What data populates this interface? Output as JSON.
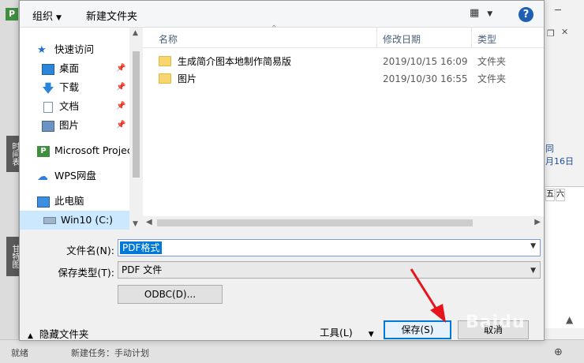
{
  "toolbar": {
    "organize": "组织",
    "new_folder": "新建文件夹",
    "help": "?"
  },
  "nav": {
    "items": [
      {
        "label": "快速访问",
        "icon": "star-icon"
      },
      {
        "label": "桌面",
        "icon": "desktop-icon",
        "pinned": true
      },
      {
        "label": "下载",
        "icon": "download-icon",
        "pinned": true
      },
      {
        "label": "文档",
        "icon": "document-icon",
        "pinned": true
      },
      {
        "label": "图片",
        "icon": "picture-icon",
        "pinned": true
      },
      {
        "label": "Microsoft Project",
        "icon": "project-icon"
      },
      {
        "label": "WPS网盘",
        "icon": "cloud-icon"
      },
      {
        "label": "此电脑",
        "icon": "computer-icon"
      },
      {
        "label": "Win10 (C:)",
        "icon": "drive-icon",
        "selected": true
      }
    ]
  },
  "files": {
    "columns": {
      "name": "名称",
      "date": "修改日期",
      "type": "类型"
    },
    "rows": [
      {
        "name": "生成简介图本地制作简易版",
        "date": "2019/10/15 16:09",
        "type": "文件夹"
      },
      {
        "name": "图片",
        "date": "2019/10/30 16:55",
        "type": "文件夹"
      }
    ]
  },
  "form": {
    "filename_label": "文件名(N):",
    "filename_value": "PDF格式",
    "filetype_label": "保存类型(T):",
    "filetype_value": "PDF 文件",
    "odbc_label": "ODBC(D)..."
  },
  "footer": {
    "hide_folders": "隐藏文件夹",
    "tools": "工具(L)",
    "save": "保存(S)",
    "cancel": "取消"
  },
  "background": {
    "side_tab_1": "时间表",
    "side_tab_2": "甘特图",
    "right_text_1": "同",
    "right_text_2": "月16日",
    "grid_col_1": "五",
    "grid_col_2": "六",
    "bottom_1": "就绪",
    "bottom_2": "新建任务：手动计划"
  },
  "colors": {
    "accent": "#0078d7",
    "selection": "#cce8ff",
    "folder": "#f7d56f",
    "annotation_arrow": "#e8141b"
  }
}
